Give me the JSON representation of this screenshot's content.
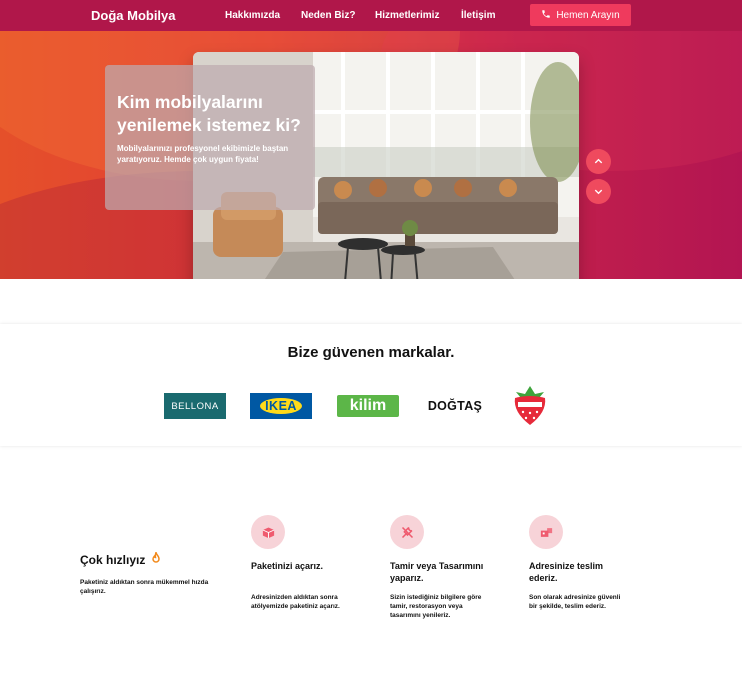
{
  "nav": {
    "brand": "Doğa Mobilya",
    "links": [
      "Hakkımızda",
      "Neden Biz?",
      "Hizmetlerimiz",
      "İletişim"
    ],
    "cta_label": "Hemen Arayın"
  },
  "hero": {
    "title": "Kim mobilyalarını yenilemek istemez ki?",
    "text": "Mobilyalarınızı profesyonel ekibimizle baştan yaratıyoruz. Hemde çok uygun fiyata!"
  },
  "brands": {
    "title": "Bize güvenen markalar.",
    "logos": [
      "BELLONA",
      "IKEA",
      "kilim",
      "DOĞTAŞ"
    ]
  },
  "features": {
    "title": "Çok hızlıyız",
    "subtitle": "Paketiniz aldıktan sonra mükemmel hızda çalışırız.",
    "steps": [
      {
        "title": "Paketinizi açarız.",
        "text": "Adresinizden aldıktan sonra atölyemizde paketiniz açarız.",
        "icon": "box-icon"
      },
      {
        "title": "Tamir veya Tasarımını yaparız.",
        "text": "Sizin istediğiniz bilgilere göre tamir, restorasyon veya tasarımını yenileriz.",
        "icon": "tools-icon"
      },
      {
        "title": "Adresinize teslim ederiz.",
        "text": "Son olarak adresinize güvenli bir şekilde, teslim ederiz.",
        "icon": "delivery-icon"
      }
    ]
  },
  "colors": {
    "nav_bg": "#b0174a",
    "accent": "#ef3a5d",
    "icon_bg": "#f7d3d8"
  }
}
